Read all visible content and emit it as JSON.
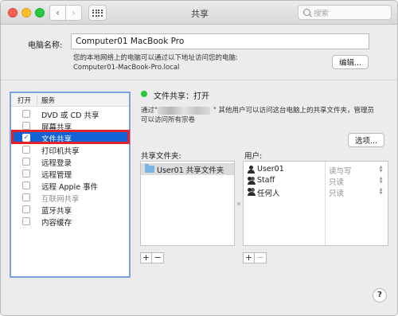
{
  "window": {
    "title": "共享",
    "search_placeholder": "搜索"
  },
  "computer_name": {
    "label": "电脑名称:",
    "value": "Computer01 MacBook Pro",
    "desc_line1": "您的本地网络上的电脑可以通过以下地址访问您的电脑:",
    "desc_line2": "Computer01-MacBook-Pro.local",
    "edit_label": "编辑..."
  },
  "services": {
    "col_on": "打开",
    "col_service": "服务",
    "items": [
      {
        "label": "DVD 或 CD 共享",
        "checked": false,
        "selected": false,
        "disabled": false
      },
      {
        "label": "屏幕共享",
        "checked": false,
        "selected": false,
        "disabled": false
      },
      {
        "label": "文件共享",
        "checked": true,
        "selected": true,
        "disabled": false
      },
      {
        "label": "打印机共享",
        "checked": false,
        "selected": false,
        "disabled": false
      },
      {
        "label": "远程登录",
        "checked": false,
        "selected": false,
        "disabled": false
      },
      {
        "label": "远程管理",
        "checked": false,
        "selected": false,
        "disabled": false
      },
      {
        "label": "远程 Apple 事件",
        "checked": false,
        "selected": false,
        "disabled": false
      },
      {
        "label": "互联网共享",
        "checked": false,
        "selected": false,
        "disabled": true
      },
      {
        "label": "蓝牙共享",
        "checked": false,
        "selected": false,
        "disabled": false
      },
      {
        "label": "内容缓存",
        "checked": false,
        "selected": false,
        "disabled": false
      }
    ]
  },
  "file_sharing": {
    "status": "文件共享：打开",
    "status_color": "#2dc53c",
    "access_prefix": "通过\"",
    "access_rest": "\" 其他用户可以访问这台电脑上的共享文件夹，管理员",
    "access_line2": "可以访问所有宗卷",
    "options_label": "选项..."
  },
  "shared_folders": {
    "label": "共享文件夹:",
    "items": [
      {
        "label": "User01 共享文件夹"
      }
    ]
  },
  "users": {
    "label": "用户:",
    "items": [
      {
        "name": "User01",
        "permission": "读与写",
        "icon": "single-user-icon"
      },
      {
        "name": "Staff",
        "permission": "只读",
        "icon": "group-icon"
      },
      {
        "name": "任何人",
        "permission": "只读",
        "icon": "everyone-icon"
      }
    ]
  },
  "controls": {
    "plus": "+",
    "minus": "−",
    "help": "?"
  },
  "accent_colors": {
    "selection": "#1262d4",
    "highlight_box": "#e3232b"
  }
}
